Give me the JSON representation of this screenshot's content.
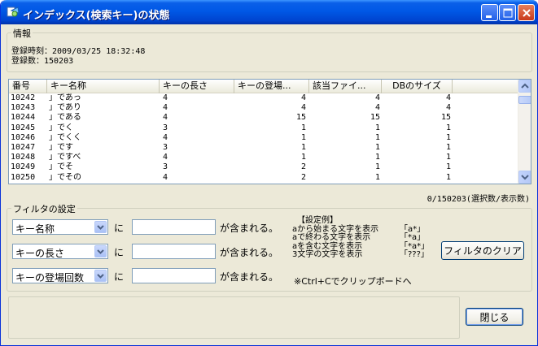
{
  "window": {
    "title": "インデックス(検索キー)の状態"
  },
  "info": {
    "legend": "情報",
    "registered_at": "登録時刻：2009/03/25 18:32:48",
    "registered_count": "登録数：150203"
  },
  "list": {
    "columns": [
      "番号",
      "キー名称",
      "キーの長さ",
      "キーの登場...",
      "該当ファイ...",
      "DBのサイズ"
    ],
    "rows": [
      [
        "10242",
        "」であっ",
        "4",
        "4",
        "4",
        "4"
      ],
      [
        "10243",
        "」であり",
        "4",
        "4",
        "4",
        "4"
      ],
      [
        "10244",
        "」である",
        "4",
        "15",
        "15",
        "15"
      ],
      [
        "10245",
        "」でく",
        "3",
        "1",
        "1",
        "1"
      ],
      [
        "10246",
        "」でくく",
        "4",
        "1",
        "1",
        "1"
      ],
      [
        "10247",
        "」です",
        "3",
        "1",
        "1",
        "1"
      ],
      [
        "10248",
        "」ですべ",
        "4",
        "1",
        "1",
        "1"
      ],
      [
        "10249",
        "」でそ",
        "3",
        "2",
        "1",
        "1"
      ],
      [
        "10250",
        "」でその",
        "4",
        "2",
        "1",
        "1"
      ]
    ],
    "count_text": "0/150203(選択数/表示数)"
  },
  "filter": {
    "legend": "フィルタの設定",
    "ni": "に",
    "contains": "が含まれる。",
    "rows": [
      {
        "field": "キー名称",
        "value": ""
      },
      {
        "field": "キーの長さ",
        "value": ""
      },
      {
        "field": "キーの登場回数",
        "value": ""
      }
    ],
    "examples_title": "【設定例】",
    "examples": [
      {
        "desc": "aから始まる文字を表示",
        "pattern": "「a*」"
      },
      {
        "desc": "aで終わる文字を表示",
        "pattern": "「*a」"
      },
      {
        "desc": "aを含む文字を表示",
        "pattern": "「*a*」"
      },
      {
        "desc": "3文字の文字を表示",
        "pattern": "「???」"
      }
    ],
    "note": "※Ctrl+Cでクリップボードへ",
    "clear_button": "フィルタのクリア"
  },
  "close_button": "閉じる",
  "colors": {
    "titlebar": "#0058e6",
    "face": "#ece9d8",
    "border_blue": "#7f9db9"
  }
}
